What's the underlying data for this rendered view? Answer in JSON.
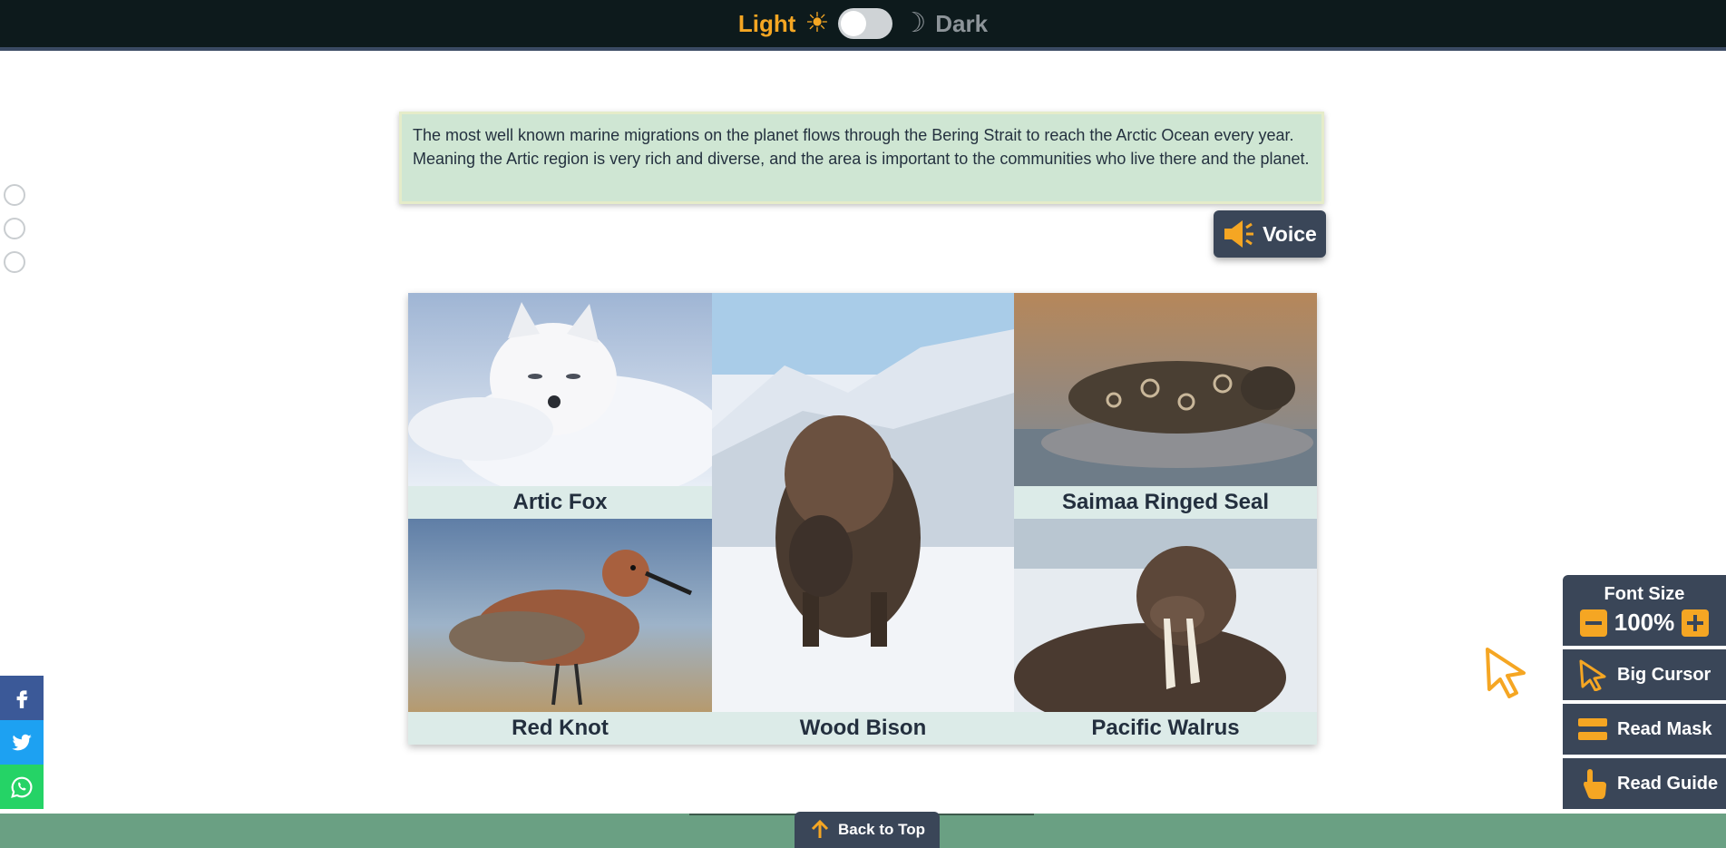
{
  "theme_toggle": {
    "light_label": "Light",
    "dark_label": "Dark",
    "sun_icon": "☀",
    "moon_icon": "☽",
    "state": "light"
  },
  "intro": {
    "text": "The most well known marine migrations on the planet flows through the Bering Strait to reach the Arctic Ocean every year. Meaning the Artic region is very rich and diverse, and the area is important to the communities who live there and the planet."
  },
  "voice_button": {
    "label": "Voice",
    "icon": "speaker-icon"
  },
  "animals": [
    {
      "name": "Artic Fox"
    },
    {
      "name": "Wood Bison"
    },
    {
      "name": "Saimaa Ringed Seal"
    },
    {
      "name": "Red Knot"
    },
    {
      "name": "Pacific Walrus"
    }
  ],
  "accessibility": {
    "font_size_title": "Font Size",
    "font_size_value": "100%",
    "big_cursor": "Big Cursor",
    "read_mask": "Read Mask",
    "read_guide": "Read Guide"
  },
  "footer": {
    "back_to_top": "Back to Top"
  },
  "colors": {
    "accent": "#f5a623",
    "panel": "#3a4658",
    "footer": "#6aa083",
    "topbar": "#0d1a1c"
  }
}
